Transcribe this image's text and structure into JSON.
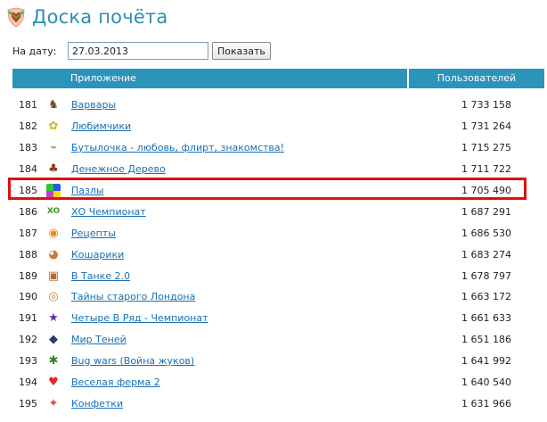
{
  "header": {
    "title": "Доска почёта",
    "logo_icon": "heart-shield-logo-icon"
  },
  "date_filter": {
    "label": "На дату:",
    "value": "27.03.2013",
    "button_label": "Показать"
  },
  "table": {
    "columns": {
      "app": "Приложение",
      "users": "Пользователей"
    },
    "rows": [
      {
        "rank": "181",
        "name": "Варвары",
        "users": "1 733 158",
        "icon": "warrior-icon",
        "color": "#6b4a2a"
      },
      {
        "rank": "182",
        "name": "Любимчики",
        "users": "1 731 264",
        "icon": "paw-icon",
        "color": "#d8b800"
      },
      {
        "rank": "183",
        "name": "Бутылочка - любовь, флирт, знакомства!",
        "users": "1 715 275",
        "icon": "bottle-icon",
        "color": "#4caa28"
      },
      {
        "rank": "184",
        "name": "Денежное Дерево",
        "users": "1 711 722",
        "icon": "tree-icon",
        "color": "#8a3a1a"
      },
      {
        "rank": "185",
        "name": "Пазлы",
        "users": "1 705 490",
        "icon": "puzzle-icon",
        "color": "#c43ad8"
      },
      {
        "rank": "186",
        "name": "ХО Чемпионат",
        "users": "1 687 291",
        "icon": "xo-icon",
        "color": "#3c9a2a"
      },
      {
        "rank": "187",
        "name": "Рецепты",
        "users": "1 686 530",
        "icon": "cooking-icon",
        "color": "#e88a1a"
      },
      {
        "rank": "188",
        "name": "Кошарики",
        "users": "1 683 274",
        "icon": "cat-icon",
        "color": "#c77a3a"
      },
      {
        "rank": "189",
        "name": "В Танке 2.0",
        "users": "1 678 797",
        "icon": "tank-icon",
        "color": "#b86a2a"
      },
      {
        "rank": "190",
        "name": "Тайны старого Лондона",
        "users": "1 663 172",
        "icon": "magnifier-icon",
        "color": "#c8862a"
      },
      {
        "rank": "191",
        "name": "Четыре В Ряд - Чемпионат",
        "users": "1 661 633",
        "icon": "star-icon",
        "color": "#6a2aa8"
      },
      {
        "rank": "192",
        "name": "Мир Теней",
        "users": "1 651 186",
        "icon": "shadow-icon",
        "color": "#2a3a6a"
      },
      {
        "rank": "193",
        "name": "Bug wars (Война жуков)",
        "users": "1 641 992",
        "icon": "bug-icon",
        "color": "#3a7a2a"
      },
      {
        "rank": "194",
        "name": "Веселая ферма 2",
        "users": "1 640 540",
        "icon": "heart-icon",
        "color": "#e02a2a"
      },
      {
        "rank": "195",
        "name": "Конфетки",
        "users": "1 631 966",
        "icon": "candy-icon",
        "color": "#e04a4a"
      }
    ]
  },
  "highlight": {
    "row_rank": "185",
    "color": "#e01010"
  }
}
